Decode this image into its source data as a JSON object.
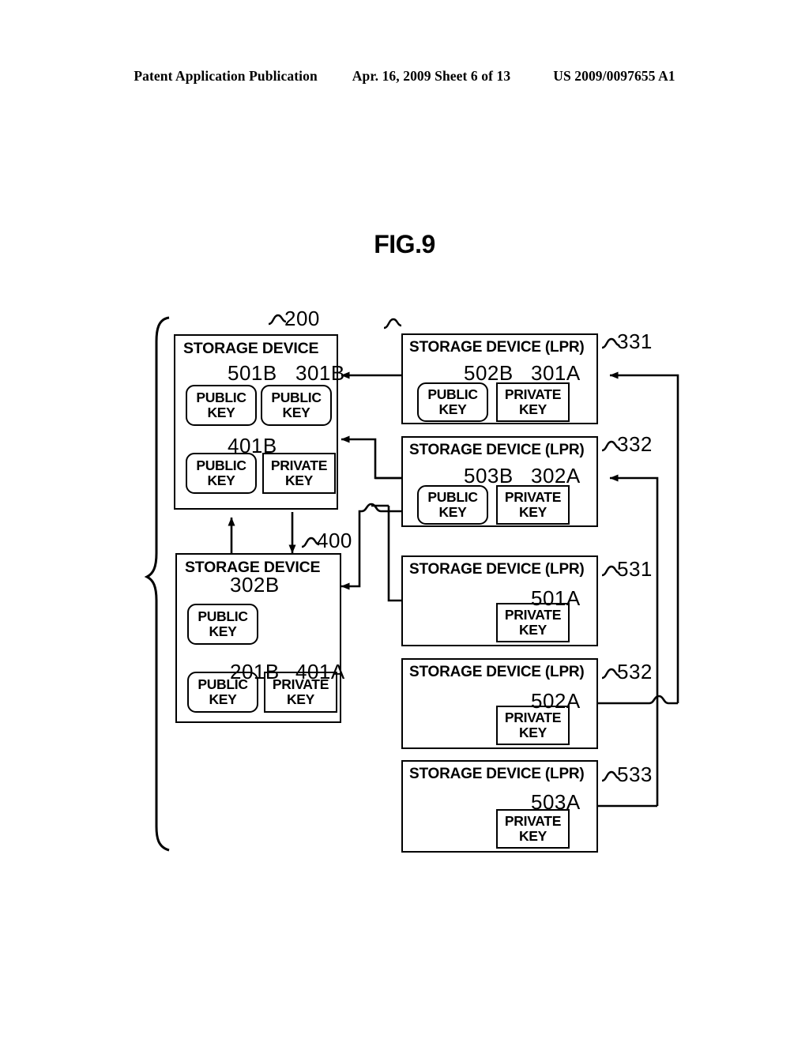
{
  "header": {
    "publication": "Patent Application Publication",
    "date": "Apr. 16, 2009",
    "sheet": "Sheet 6 of 13",
    "patent_number": "US 2009/0097655 A1"
  },
  "figure": {
    "title": "FIG.9",
    "labels": {
      "storage_device": "STORAGE DEVICE",
      "storage_device_lpr": "STORAGE DEVICE (LPR)",
      "public_key_l1": "PUBLIC",
      "public_key_l2": "KEY",
      "private_key_l1": "PRIVATE",
      "private_key_l2": "KEY"
    },
    "boxes": [
      {
        "id": "dev-200",
        "ref": "200",
        "title": "STORAGE DEVICE",
        "keys": [
          {
            "ref": "501B",
            "type": "public"
          },
          {
            "ref": "301B",
            "type": "public"
          },
          {
            "ref": "401B",
            "type": "public"
          },
          {
            "ref": "",
            "type": "private"
          }
        ]
      },
      {
        "id": "dev-400",
        "ref": "400",
        "title": "STORAGE DEVICE",
        "keys": [
          {
            "ref": "302B",
            "type": "public"
          },
          {
            "ref": "201B",
            "type": "public"
          },
          {
            "ref": "401A",
            "type": "private"
          }
        ]
      },
      {
        "id": "dev-331",
        "ref": "331",
        "title": "STORAGE DEVICE (LPR)",
        "keys": [
          {
            "ref": "502B",
            "type": "public"
          },
          {
            "ref": "301A",
            "type": "private"
          }
        ]
      },
      {
        "id": "dev-332",
        "ref": "332",
        "title": "STORAGE DEVICE (LPR)",
        "keys": [
          {
            "ref": "503B",
            "type": "public"
          },
          {
            "ref": "302A",
            "type": "private"
          }
        ]
      },
      {
        "id": "dev-531",
        "ref": "531",
        "title": "STORAGE DEVICE (LPR)",
        "keys": [
          {
            "ref": "501A",
            "type": "private"
          }
        ]
      },
      {
        "id": "dev-532",
        "ref": "532",
        "title": "STORAGE DEVICE (LPR)",
        "keys": [
          {
            "ref": "502A",
            "type": "private"
          }
        ]
      },
      {
        "id": "dev-533",
        "ref": "533",
        "title": "STORAGE DEVICE (LPR)",
        "keys": [
          {
            "ref": "503A",
            "type": "private"
          }
        ]
      }
    ]
  }
}
